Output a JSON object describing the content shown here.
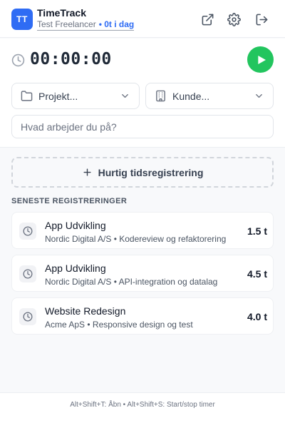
{
  "header": {
    "logo_text": "TT",
    "app_title": "TimeTrack",
    "user_name": "Test Freelancer",
    "today_total": "• 0t i dag",
    "icons": [
      "external-link-icon",
      "gear-icon",
      "logout-icon"
    ]
  },
  "timer": {
    "display": "00:00:00"
  },
  "selectors": {
    "project_placeholder": "Projekt...",
    "customer_placeholder": "Kunde..."
  },
  "description": {
    "placeholder": "Hvad arbejder du på?",
    "value": ""
  },
  "quick_entry": {
    "label": "Hurtig tidsregistrering"
  },
  "recent": {
    "title": "SENESTE REGISTRERINGER",
    "entries": [
      {
        "title": "App Udvikling",
        "subtitle": "Nordic Digital A/S • Kodereview og refaktorering",
        "hours": "1.5 t"
      },
      {
        "title": "App Udvikling",
        "subtitle": "Nordic Digital A/S • API-integration og datalag",
        "hours": "4.5 t"
      },
      {
        "title": "Website Redesign",
        "subtitle": "Acme ApS • Responsive design og test",
        "hours": "4.0 t"
      }
    ]
  },
  "footer": {
    "shortcuts": "Alt+Shift+T: Åbn • Alt+Shift+S: Start/stop timer"
  },
  "colors": {
    "accent": "#2f6cf4",
    "play": "#22c55e"
  }
}
